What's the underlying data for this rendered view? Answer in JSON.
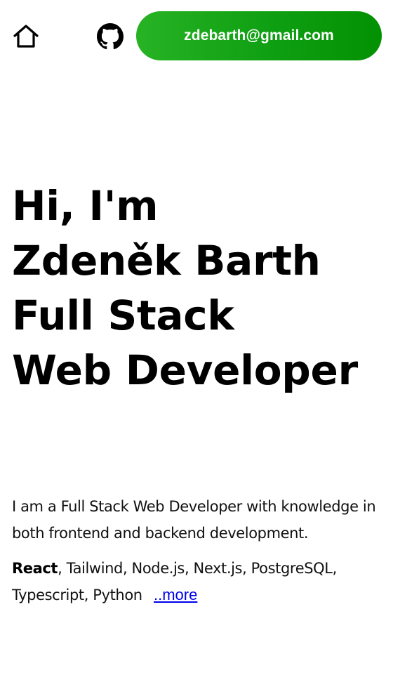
{
  "nav": {
    "home_icon": "home-icon",
    "github_icon": "github-icon",
    "email": "zdebarth@gmail.com",
    "email_button_gradient": [
      "#27b324",
      "#029102"
    ]
  },
  "hero": {
    "line1": "Hi, I'm",
    "line2": "Zdeněk Barth",
    "line3": "Full Stack",
    "line4": "Web Developer"
  },
  "intro": {
    "text": "I am a Full Stack Web Developer with knowledge in both frontend and backend development."
  },
  "skills": {
    "primary": "React",
    "rest": ", Tailwind, Node.js, Next.js, PostgreSQL, Typescript, Python",
    "more_link": "..more",
    "link_color": "#0000ee"
  }
}
